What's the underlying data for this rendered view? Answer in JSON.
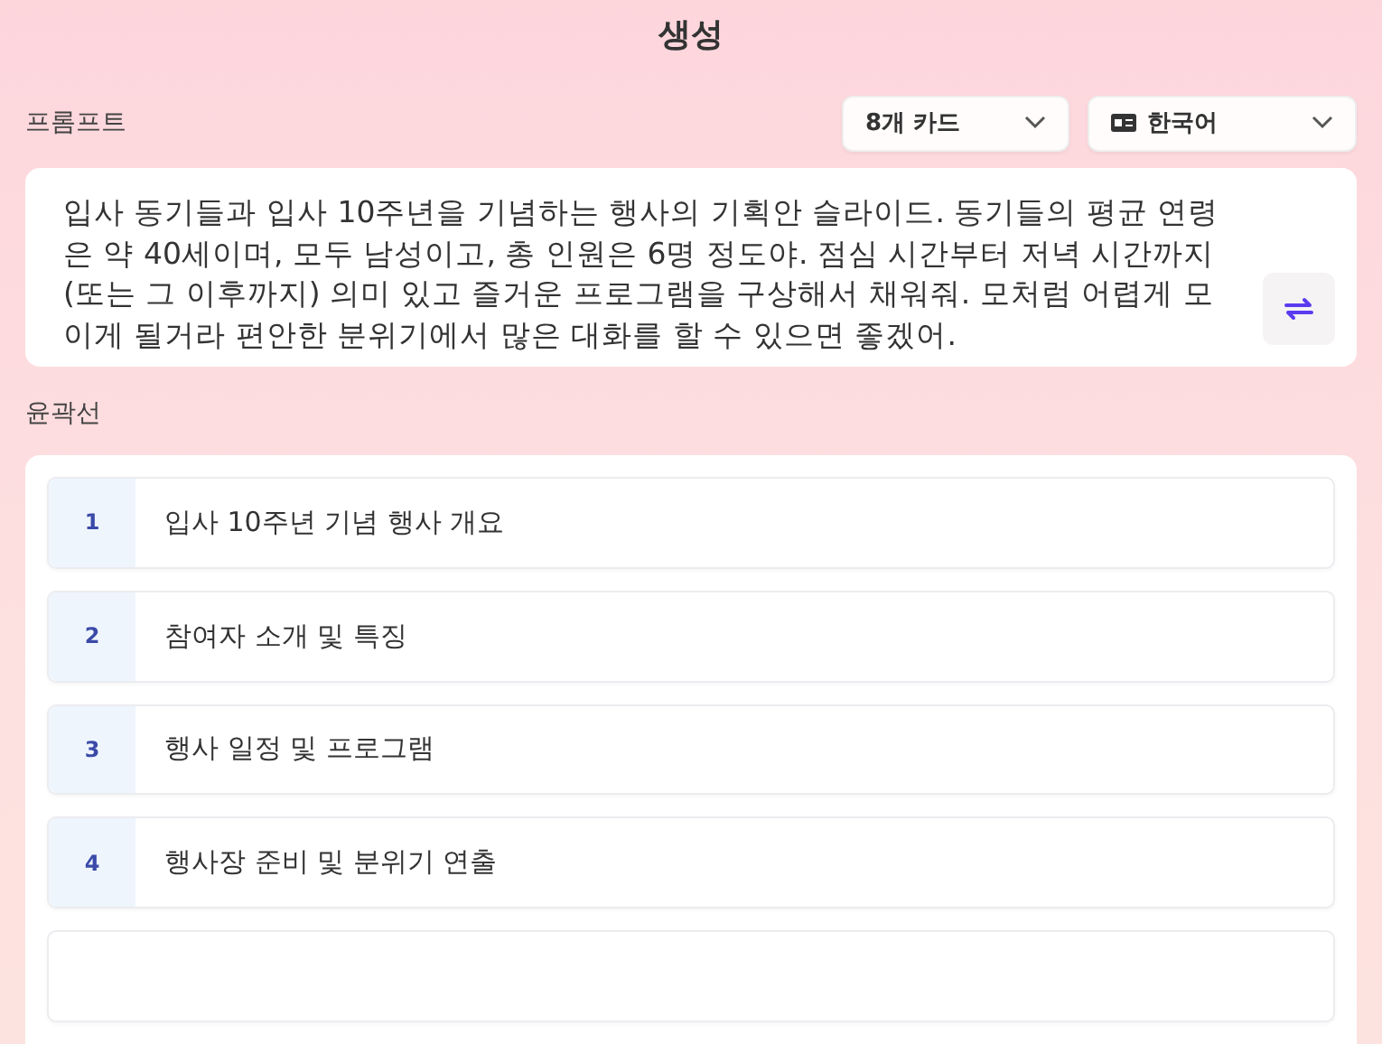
{
  "title": "생성",
  "prompt": {
    "label": "프롬프트",
    "value": "입사 동기들과 입사 10주년을 기념하는 행사의 기획안 슬라이드. 동기들의 평균 연령은 약 40세이며, 모두 남성이고, 총 인원은 6명 정도야. 점심 시간부터 저녁 시간까지 (또는 그 이후까지) 의미 있고 즐거운 프로그램을 구상해서 채워줘. 모처럼 어렵게 모이게 될거라 편안한 분위기에서 많은 대화를 할 수 있으면 좋겠어."
  },
  "dropdowns": [
    {
      "kind": "count",
      "value": "8개 카드"
    },
    {
      "kind": "language",
      "value": "한국어"
    }
  ],
  "outline": {
    "label": "윤곽선",
    "items": [
      {
        "number": "1",
        "title": "입사 10주년 기념 행사 개요"
      },
      {
        "number": "2",
        "title": "참여자 소개 및 특징"
      },
      {
        "number": "3",
        "title": "행사 일정 및 프로그램"
      },
      {
        "number": "4",
        "title": "행사장 준비 및 분위기 연출"
      }
    ]
  }
}
